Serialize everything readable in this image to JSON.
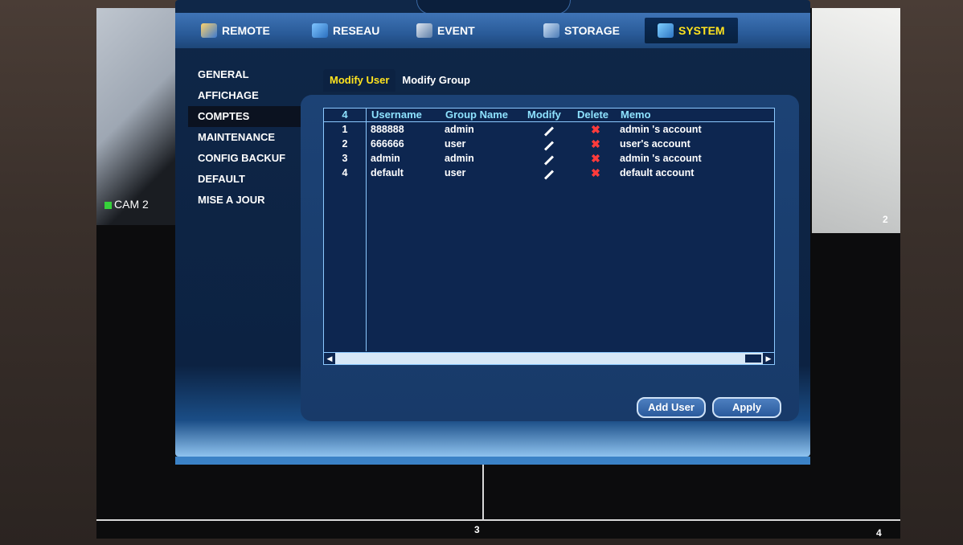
{
  "camera": {
    "label": "CAM 2",
    "num_2": "2",
    "num_3": "3",
    "num_4": "4"
  },
  "tabs": [
    {
      "label": "REMOTE"
    },
    {
      "label": "RESEAU"
    },
    {
      "label": "EVENT"
    },
    {
      "label": "STORAGE"
    },
    {
      "label": "SYSTEM"
    }
  ],
  "sidebar": {
    "items": [
      {
        "label": "GENERAL"
      },
      {
        "label": "AFFICHAGE"
      },
      {
        "label": "COMPTES"
      },
      {
        "label": "MAINTENANCE"
      },
      {
        "label": "CONFIG BACKUF"
      },
      {
        "label": "DEFAULT"
      },
      {
        "label": "MISE A JOUR"
      }
    ]
  },
  "subtabs": {
    "modify_user": "Modify User",
    "modify_group": "Modify Group"
  },
  "table": {
    "count": "4",
    "headers": {
      "username": "Username",
      "group": "Group Name",
      "modify": "Modify",
      "delete": "Delete",
      "memo": "Memo"
    },
    "rows": [
      {
        "num": "1",
        "username": "888888",
        "group": "admin",
        "memo": "admin 's account"
      },
      {
        "num": "2",
        "username": "666666",
        "group": "user",
        "memo": "user's account"
      },
      {
        "num": "3",
        "username": "admin",
        "group": "admin",
        "memo": "admin 's account"
      },
      {
        "num": "4",
        "username": "default",
        "group": "user",
        "memo": "default account"
      }
    ]
  },
  "buttons": {
    "add_user": "Add User",
    "apply": "Apply"
  },
  "icons": {
    "modify": "pencil-icon",
    "delete": "x-icon"
  }
}
